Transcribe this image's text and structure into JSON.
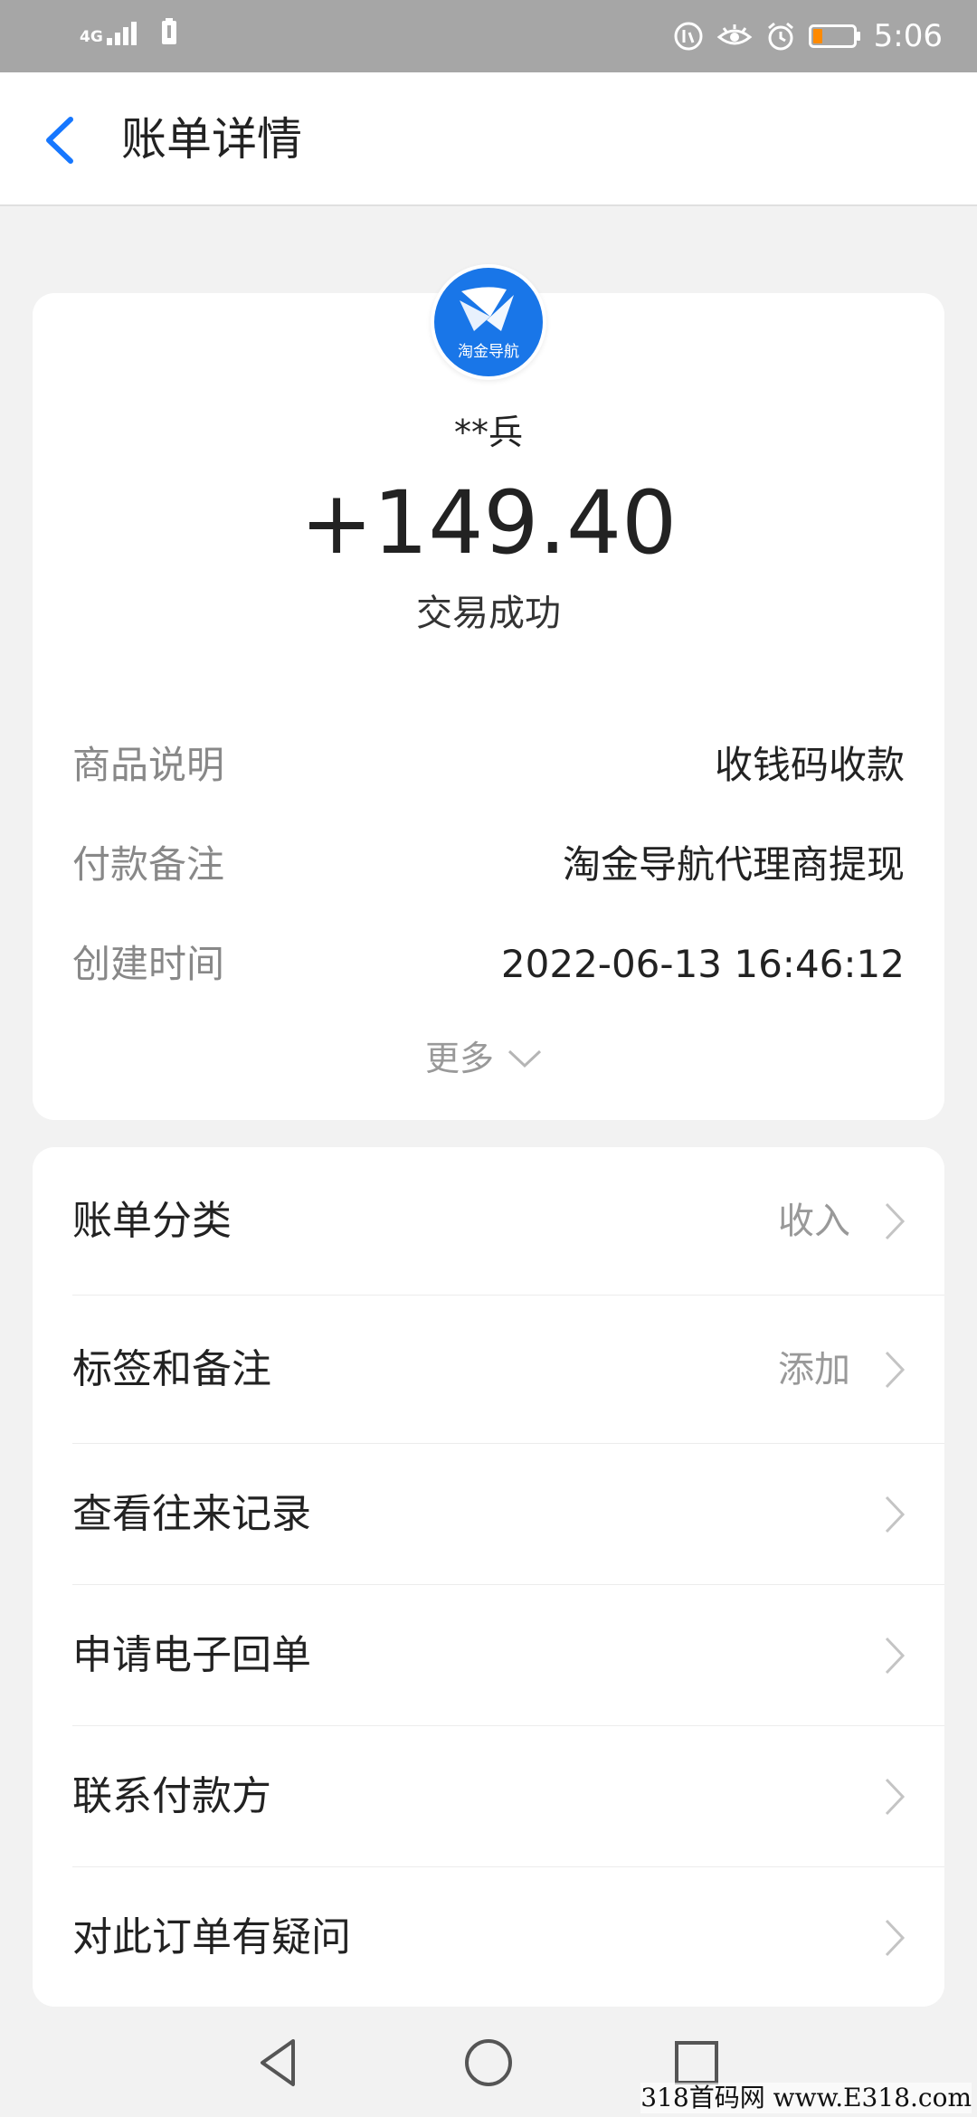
{
  "status_bar": {
    "network": "4G",
    "time": "5:06"
  },
  "header": {
    "title": "账单详情"
  },
  "payee": {
    "logo_text": "淘金导航",
    "name": "**兵",
    "amount": "+149.40",
    "status": "交易成功"
  },
  "details": [
    {
      "label": "商品说明",
      "value": "收钱码收款"
    },
    {
      "label": "付款备注",
      "value": "淘金导航代理商提现"
    },
    {
      "label": "创建时间",
      "value": "2022-06-13 16:46:12"
    }
  ],
  "more_label": "更多",
  "menu": [
    {
      "label": "账单分类",
      "value": "收入"
    },
    {
      "label": "标签和备注",
      "value": "添加"
    },
    {
      "label": "查看往来记录",
      "value": ""
    },
    {
      "label": "申请电子回单",
      "value": ""
    },
    {
      "label": "联系付款方",
      "value": ""
    },
    {
      "label": "对此订单有疑问",
      "value": ""
    }
  ],
  "watermark": "318首码网 www.E318.com",
  "colors": {
    "accent": "#1677ff",
    "status_bar": "#a6a6a6",
    "battery_low": "#ff8a00"
  }
}
